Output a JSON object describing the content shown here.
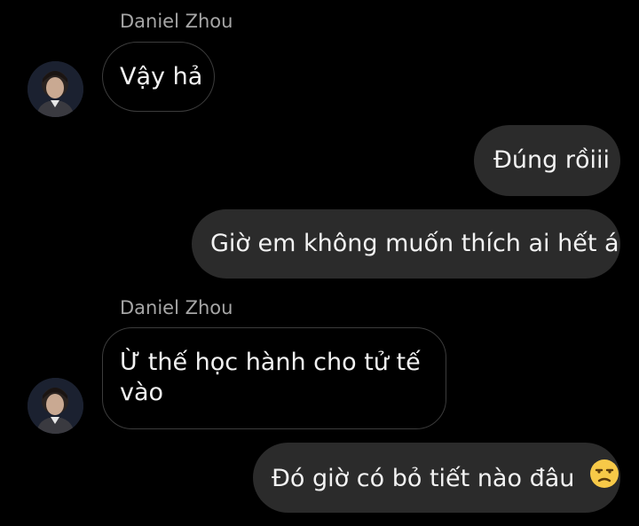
{
  "colors": {
    "background": "#000000",
    "incoming_bubble_border": "#3c3c3c",
    "outgoing_bubble_bg": "#2b2b2b",
    "sender_name": "#a6a6a6",
    "message_text": "#f2f2f2"
  },
  "messages": [
    {
      "sender": "Daniel Zhou",
      "direction": "incoming",
      "text": "Vậy hả"
    },
    {
      "direction": "outgoing",
      "text": "Đúng rồiii"
    },
    {
      "direction": "outgoing",
      "text": "Giờ em không muốn thích ai hết á"
    },
    {
      "sender": "Daniel Zhou",
      "direction": "incoming",
      "text_line1": "Ừ thế học hành cho tử tế",
      "text_line2": "vào"
    },
    {
      "direction": "outgoing",
      "text": "Đó giờ có bỏ tiết nào đâu",
      "emoji": "unamused-face-icon"
    }
  ]
}
